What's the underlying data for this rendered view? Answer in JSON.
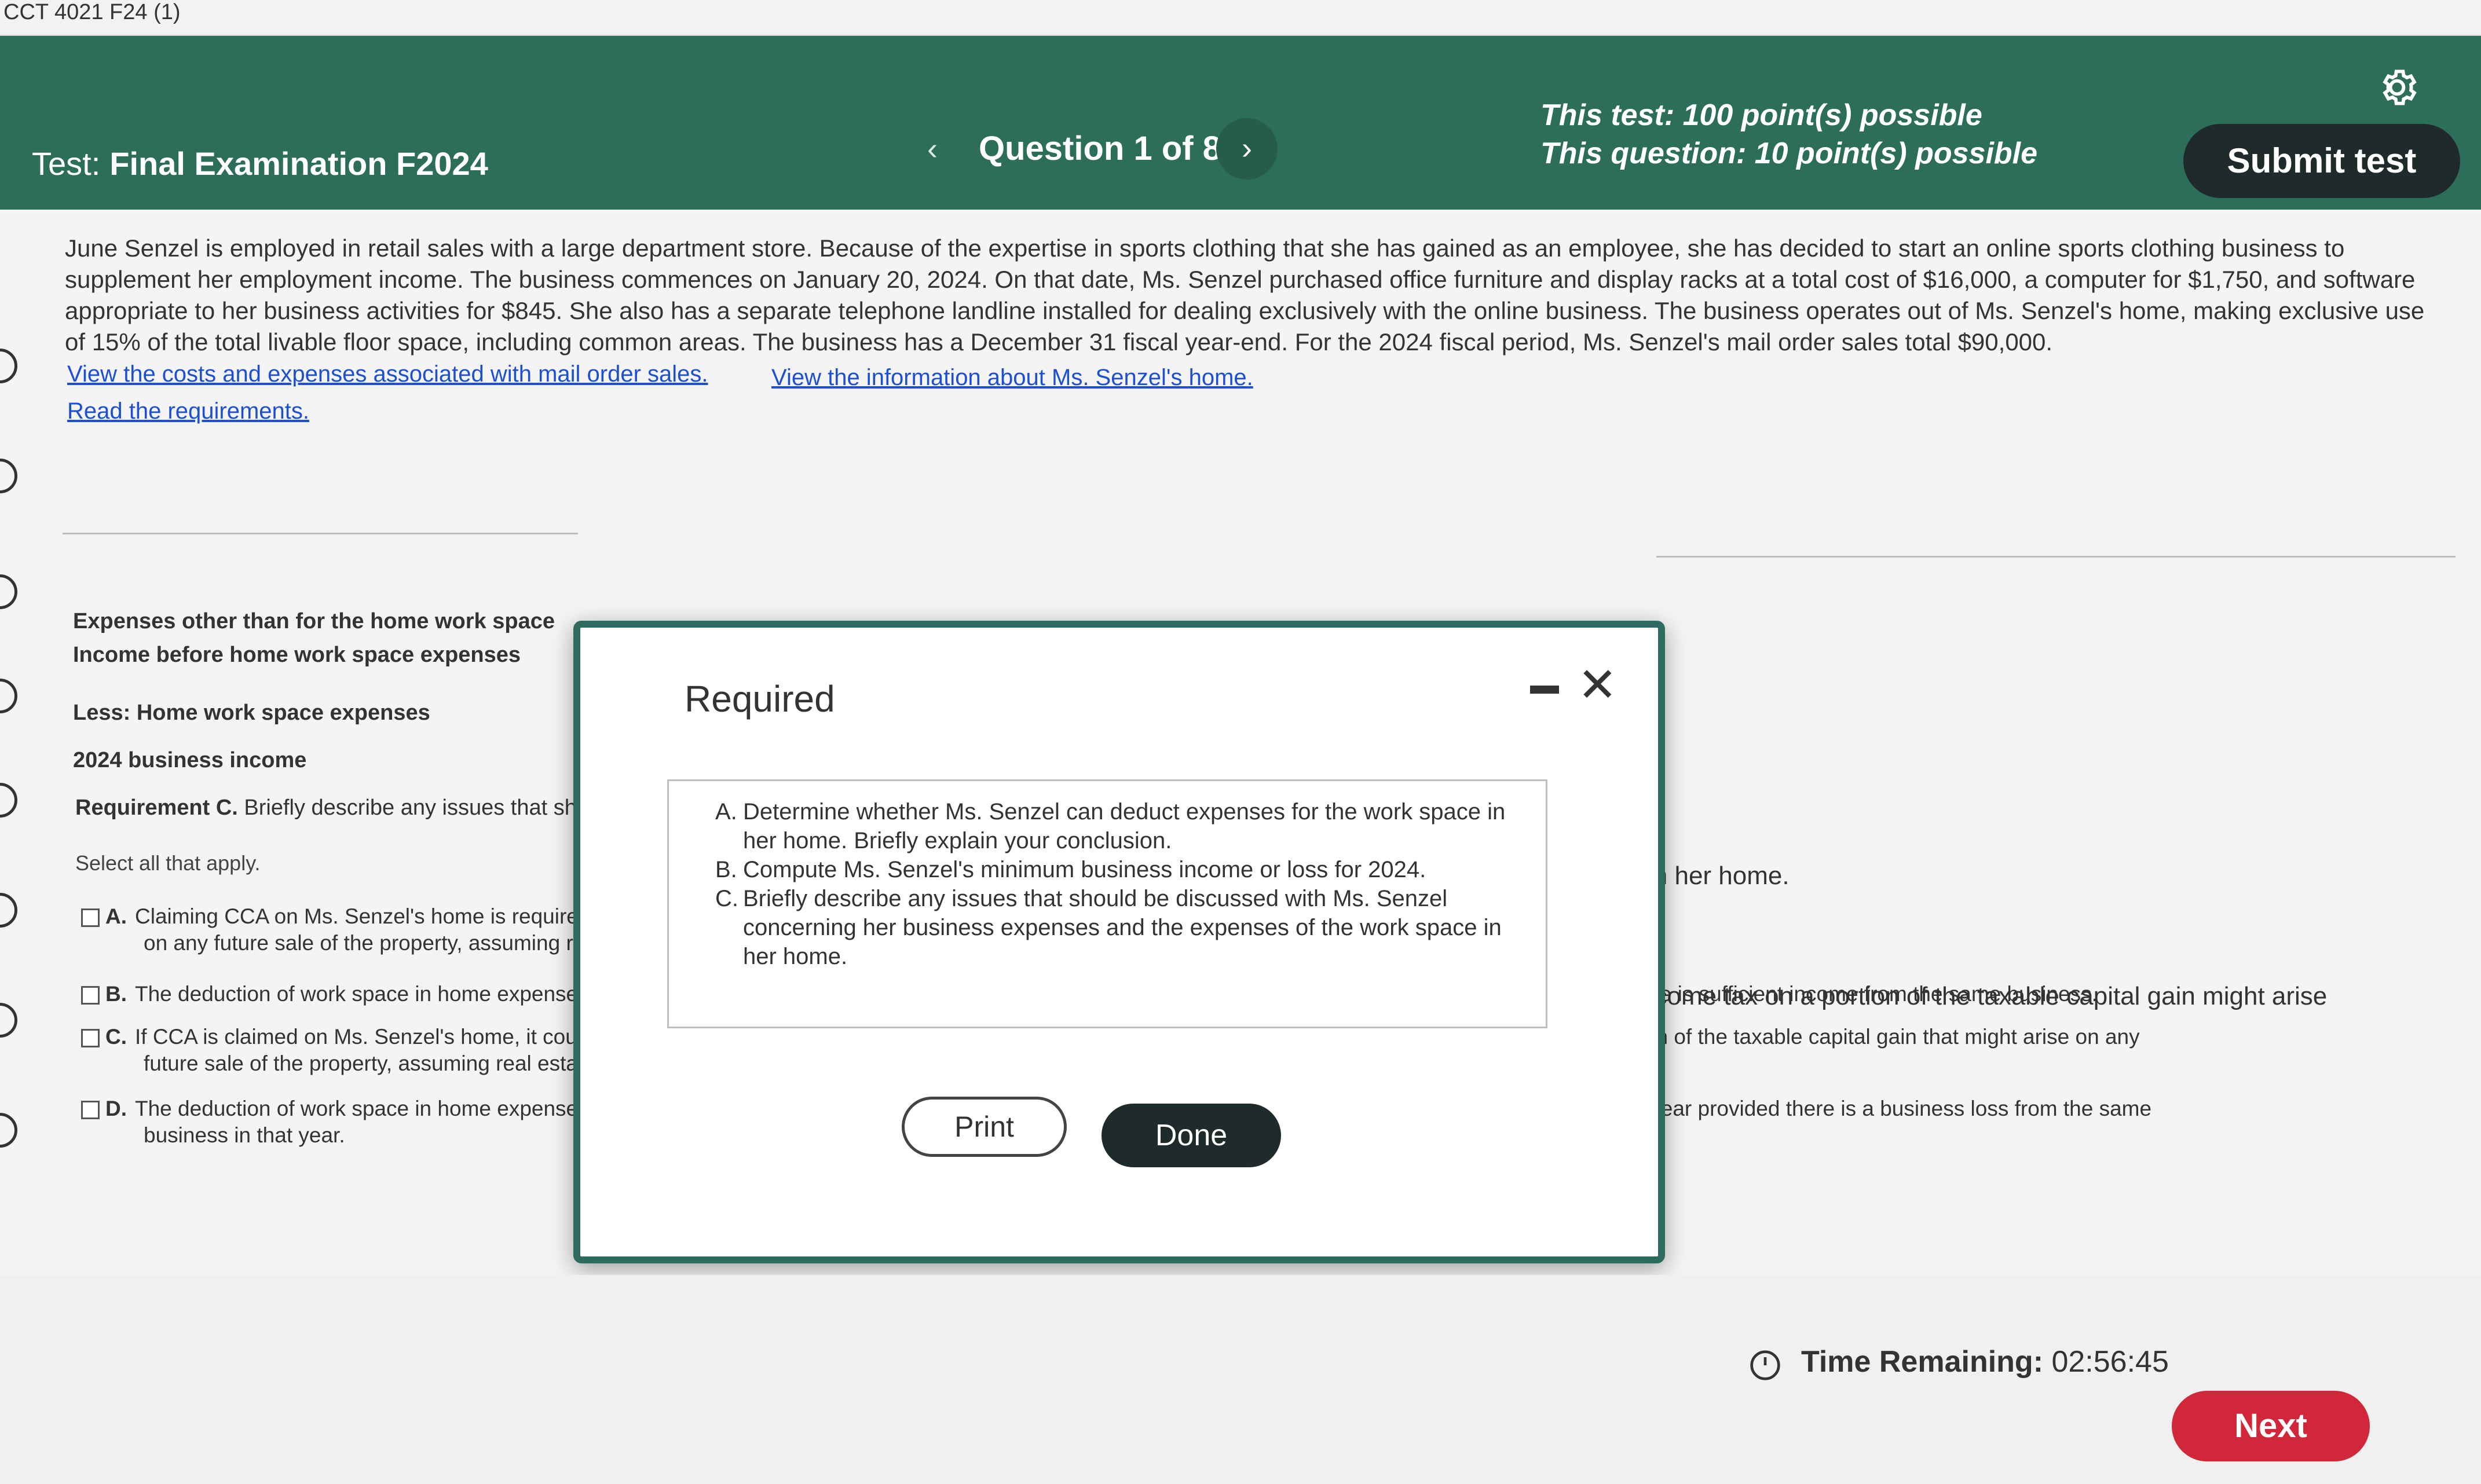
{
  "window": {
    "tab_title": "CCT 4021 F24 (1)"
  },
  "header": {
    "test_prefix": "Test:",
    "test_name": "Final Examination F2024",
    "question_label": "Question 1 of 8",
    "test_points": "This test: 100 point(s) possible",
    "question_points": "This question: 10 point(s) possible",
    "submit_label": "Submit test"
  },
  "problem": {
    "text": "June Senzel is employed in retail sales with a large department store. Because of the expertise in sports clothing that she has gained as an employee, she has decided to start an online sports clothing business to supplement her employment income. The business commences on January 20, 2024. On that date, Ms. Senzel purchased office furniture and display racks at a total cost of $16,000, a computer for $1,750, and software appropriate to her business activities for $845. She also has a separate telephone landline installed for dealing exclusively with the online business. The business operates out of Ms. Senzel's home, making exclusive use of 15% of the total livable floor space, including common areas. The business has a December 31 fiscal year-end. For the 2024 fiscal period, Ms. Senzel's mail order sales total $90,000.",
    "link_costs": "View the costs and expenses associated with mail order sales.",
    "link_home": "View the information about Ms. Senzel's home.",
    "link_requirements": "Read the requirements."
  },
  "income_table": {
    "row1": "Expenses other than for the home work space",
    "row2": "Income before home work space expenses",
    "row3": "Less: Home work space expenses",
    "row4": "2024 business income"
  },
  "requirement_c": {
    "prefix": "Requirement C.",
    "text": "Briefly describe any issues that shoul",
    "select_all": "Select all that apply.",
    "options": [
      {
        "letter": "A.",
        "line1": "Claiming CCA on Ms. Senzel's home is require",
        "line2": "on any future sale of the property, assuming re"
      },
      {
        "letter": "B.",
        "line1": "The deduction of work space in home expenses cannot be used to create or increase a business loss, but can be deducted in any subsequent year provided there is sufficient income from the same business.",
        "line2": ""
      },
      {
        "letter": "C.",
        "line1": "If CCA is claimed on Ms. Senzel's home, it could jeopardize the principal residence exemption on this property, resulting in the payment of income tax on a portion of the taxable capital gain that might arise on any",
        "line2": "future sale of the property, assuming real estate prices are increasing."
      },
      {
        "letter": "D.",
        "line1": "The deduction of work space in home expenses is only allowed when there is a business loss. If there is not, the deduction can only be applied in a subsequent year provided there is a business loss from the same",
        "line2": "business in that year."
      }
    ],
    "right_fragment_1": "in her home.",
    "right_fragment_2": "ncome tax on a portion of the taxable capital gain might arise"
  },
  "modal": {
    "title": "Required",
    "items": [
      {
        "letter": "A.",
        "line1": "Determine whether Ms. Senzel can deduct expenses for the work space in",
        "line2": "her home. Briefly explain your conclusion."
      },
      {
        "letter": "B.",
        "line1": "Compute Ms. Senzel's minimum business income or loss for 2024.",
        "line2": ""
      },
      {
        "letter": "C.",
        "line1": "Briefly describe any issues that should be discussed with Ms. Senzel",
        "line2": "concerning her business expenses and the expenses of the work space in",
        "line3": "her home."
      }
    ],
    "print_label": "Print",
    "done_label": "Done"
  },
  "footer": {
    "time_label": "Time Remaining:",
    "time_value": "02:56:45",
    "next_label": "Next"
  }
}
